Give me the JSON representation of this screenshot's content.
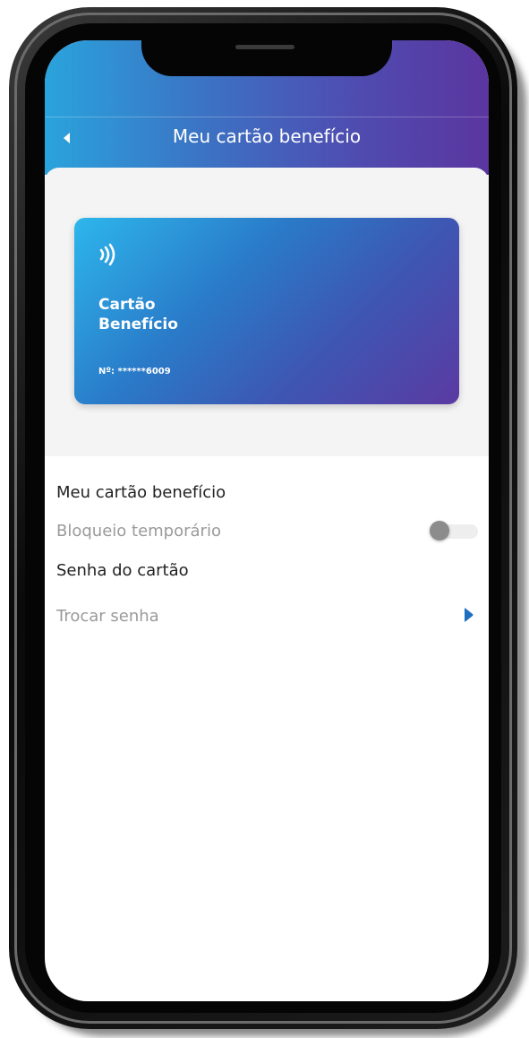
{
  "header": {
    "title": "Meu cartão benefício",
    "back_icon": "back-arrow-icon"
  },
  "card": {
    "name_line1": "Cartão",
    "name_line2": "Benefício",
    "number": "Nº: ******6009",
    "contactless_icon": "contactless-icon"
  },
  "settings": {
    "card_section_title": "Meu cartão benefício",
    "temp_block_label": "Bloqueio temporário",
    "temp_block_enabled": false,
    "password_section_title": "Senha do cartão",
    "change_password_label": "Trocar senha",
    "change_password_icon": "chevron-right-icon"
  },
  "colors": {
    "header_gradient_start": "#2aa3dc",
    "header_gradient_end": "#5b35a0",
    "card_gradient_start": "#2db6ec",
    "card_gradient_end": "#5b3aa2",
    "chevron": "#1f6fc0"
  }
}
